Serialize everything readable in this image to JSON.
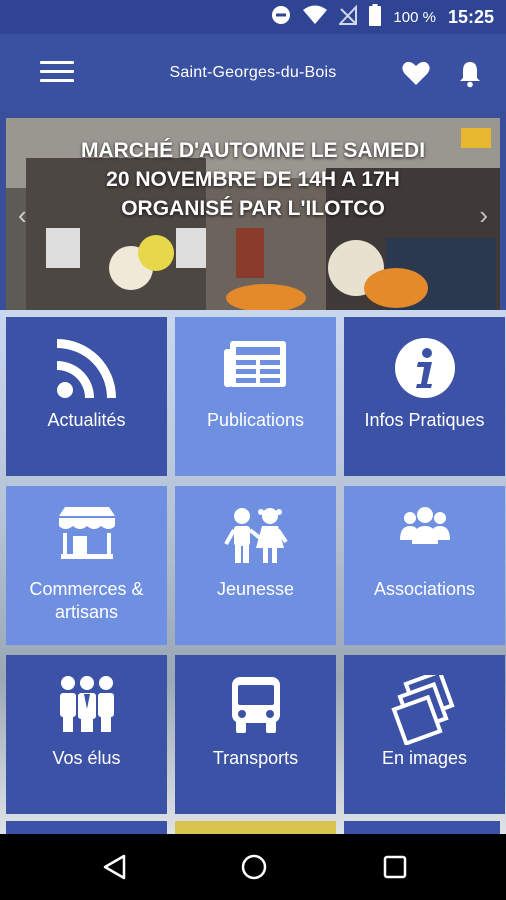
{
  "status_bar": {
    "battery_pct": "100 %",
    "time": "15:25",
    "icons": [
      "do-not-disturb-icon",
      "wifi-icon",
      "no-signal-icon",
      "battery-icon"
    ]
  },
  "app_bar": {
    "title": "Saint-Georges-du-Bois",
    "icons": [
      "menu-icon",
      "heart-icon",
      "bell-icon"
    ]
  },
  "banner": {
    "headline_line1": "MARCHÉ D'AUTOMNE LE SAMEDI",
    "headline_line2": "20 NOVEMBRE DE 14H A 17H",
    "headline_line3": "ORGANISÉ PAR L'ILOTCO",
    "prev_arrow": "‹",
    "next_arrow": "›"
  },
  "tiles": [
    {
      "label": "Actualités",
      "icon": "rss-icon"
    },
    {
      "label": "Publications",
      "icon": "newspaper-icon"
    },
    {
      "label": "Infos Pratiques",
      "icon": "info-icon"
    },
    {
      "label_line1": "Commerces &",
      "label_line2": "artisans",
      "icon": "shop-icon"
    },
    {
      "label": "Jeunesse",
      "icon": "children-icon"
    },
    {
      "label": "Associations",
      "icon": "group-icon"
    },
    {
      "label": "Vos élus",
      "icon": "officials-icon"
    },
    {
      "label": "Transports",
      "icon": "bus-icon"
    },
    {
      "label": "En images",
      "icon": "photos-icon"
    }
  ],
  "colors": {
    "primary": "#3a50a0",
    "tile_dark": "#3b52a6",
    "tile_light": "#6f8fe0"
  },
  "nav_bar": {
    "icons": [
      "back-icon",
      "home-icon",
      "recents-icon"
    ]
  }
}
